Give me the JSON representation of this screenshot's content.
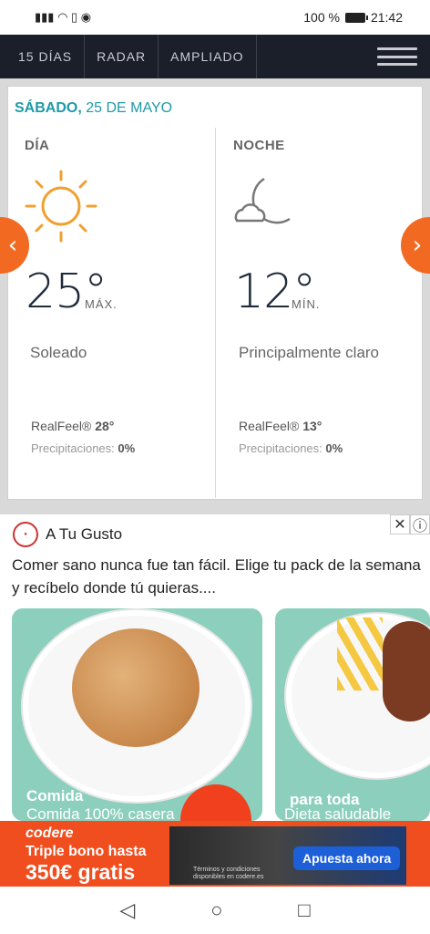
{
  "status_bar": {
    "signal": "📶",
    "battery_pct": "100 %",
    "time": "21:42"
  },
  "nav": {
    "tabs": [
      "15 DÍAS",
      "RADAR",
      "AMPLIADO"
    ],
    "menu_icon": "hamburger-icon"
  },
  "forecast": {
    "date_day": "SÁBADO,",
    "date_rest": " 25 DE MAYO",
    "day": {
      "label": "DÍA",
      "temp": "25°",
      "unit": "MÁX.",
      "desc": "Soleado",
      "realfeel_label": "RealFeel®",
      "realfeel": "28°",
      "precip_label": "Precipitaciones:",
      "precip": "0%"
    },
    "night": {
      "label": "NOCHE",
      "temp": "12°",
      "unit": "MÍN.",
      "desc": "Principalmente claro",
      "realfeel_label": "RealFeel®",
      "realfeel": "13°",
      "precip_label": "Precipitaciones:",
      "precip": "0%"
    },
    "prev_glyph": "‹",
    "next_glyph": "›"
  },
  "ad": {
    "brand": "A Tu Gusto",
    "close": "✕",
    "info": "ⓘ",
    "text": "Comer sano nunca fue tan fácil. Elige tu pack de la semana y recíbelo donde tú quieras....",
    "tiles": [
      {
        "overlay": "Comida",
        "caption": "Comida 100% casera"
      },
      {
        "overlay": "para toda",
        "caption": "Dieta saludable"
      }
    ],
    "fab_glyph": "⌄"
  },
  "banner": {
    "brand": "codere",
    "line1": "Triple bono hasta",
    "line2": "350€ gratis",
    "cta": "Apuesta ahora",
    "small": "Términos y condiciones disponibles en codere.es"
  },
  "colors": {
    "accent": "#1e9aa8",
    "orange": "#f26a21",
    "navbar": "#1b1f2a"
  }
}
